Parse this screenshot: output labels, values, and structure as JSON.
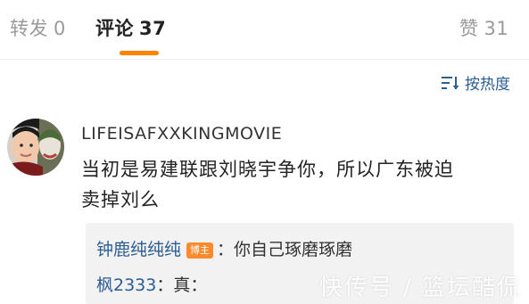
{
  "tabs": {
    "repost": {
      "label": "转发",
      "count": "0"
    },
    "comment": {
      "label": "评论",
      "count": "37"
    },
    "like": {
      "label": "赞",
      "count": "31"
    }
  },
  "sort": {
    "label": "按热度",
    "icon": "sort-lines-icon"
  },
  "comment": {
    "avatar_icon": "user-avatar",
    "username": "LIFEISAFXXKINGMOVIE",
    "text": "当初是易建联跟刘晓宇争你，所以广东被迫卖掉刘么"
  },
  "replies": [
    {
      "user": "钟鹿纯纯纯",
      "badge": "博主",
      "text": "：你自己琢磨琢磨"
    },
    {
      "user": "枫2333",
      "badge": "",
      "text": "：真："
    }
  ],
  "watermark": "快传号 / 篮坛酷侃",
  "colors": {
    "accent": "#ff8200",
    "link": "#2c5d93",
    "badge": "#ff8a2b",
    "reply_bg": "#f2f2f2"
  }
}
